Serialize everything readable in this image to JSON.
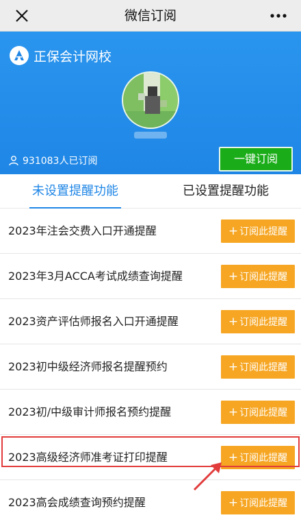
{
  "topbar": {
    "title": "微信订阅"
  },
  "hero": {
    "brand_name": "正保会计网校",
    "subscriber_text": "931083人已订阅",
    "subscribe_all_label": "一键订阅"
  },
  "tabs": [
    {
      "label": "未设置提醒功能",
      "active": true
    },
    {
      "label": "已设置提醒功能",
      "active": false
    }
  ],
  "items": [
    {
      "label": "2023年注会交费入口开通提醒",
      "button": "订阅此提醒"
    },
    {
      "label": "2023年3月ACCA考试成绩查询提醒",
      "button": "订阅此提醒"
    },
    {
      "label": "2023资产评估师报名入口开通提醒",
      "button": "订阅此提醒"
    },
    {
      "label": "2023初中级经济师报名提醒预约",
      "button": "订阅此提醒"
    },
    {
      "label": "2023初/中级审计师报名预约提醒",
      "button": "订阅此提醒"
    },
    {
      "label": "2023高级经济师准考证打印提醒",
      "button": "订阅此提醒",
      "highlighted": true
    },
    {
      "label": "2023高会成绩查询预约提醒",
      "button": "订阅此提醒"
    }
  ],
  "colors": {
    "hero_blue": "#1f86e6",
    "subscribe_green": "#1aad19",
    "button_orange": "#f6a623",
    "highlight_red": "#e23b3b"
  },
  "icons": [
    "close-icon",
    "more-icon",
    "brand-logo-icon",
    "user-icon",
    "plus-icon",
    "arrow-annotation"
  ]
}
